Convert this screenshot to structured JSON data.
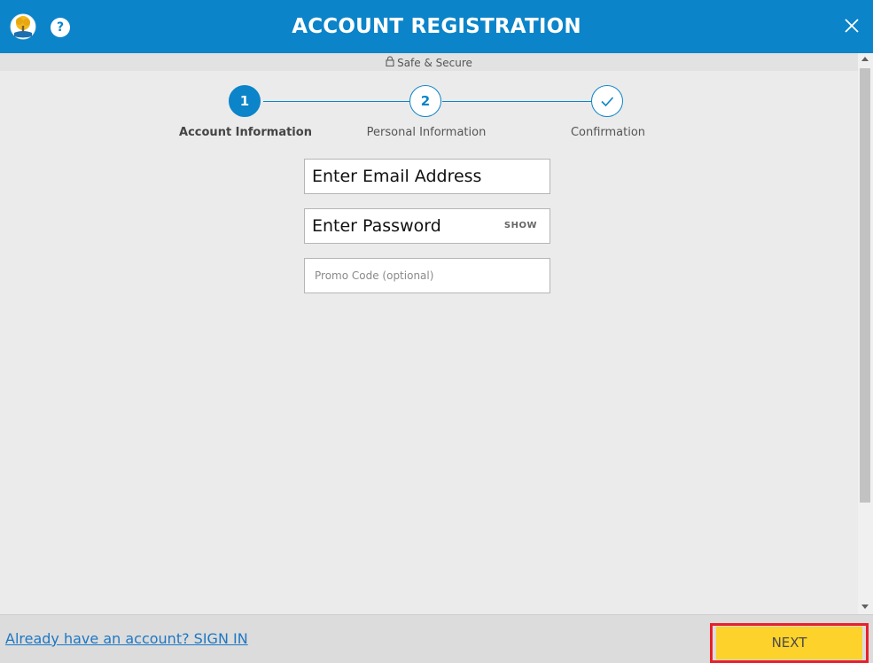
{
  "header": {
    "title": "ACCOUNT REGISTRATION",
    "help_label": "?",
    "logo_icon": "tree-logo-icon",
    "close_icon": "close-icon",
    "color": "#0b84c9"
  },
  "secure": {
    "label": "Safe & Secure",
    "icon": "lock-icon"
  },
  "stepper": {
    "steps": [
      {
        "number": "1",
        "label": "Account Information",
        "state": "active"
      },
      {
        "number": "2",
        "label": "Personal Information",
        "state": "upcoming"
      },
      {
        "number": "",
        "label": "Confirmation",
        "state": "upcoming",
        "icon": "checkmark-icon"
      }
    ]
  },
  "form": {
    "email": {
      "value": "Enter Email Address"
    },
    "password": {
      "value": "Enter Password",
      "show_label": "SHOW"
    },
    "promo": {
      "placeholder": "Promo Code (optional)"
    }
  },
  "footer": {
    "signin_text": "Already have an account? SIGN IN",
    "next_label": "NEXT",
    "next_color": "#fdd22b",
    "highlight_color": "#e8202a"
  }
}
